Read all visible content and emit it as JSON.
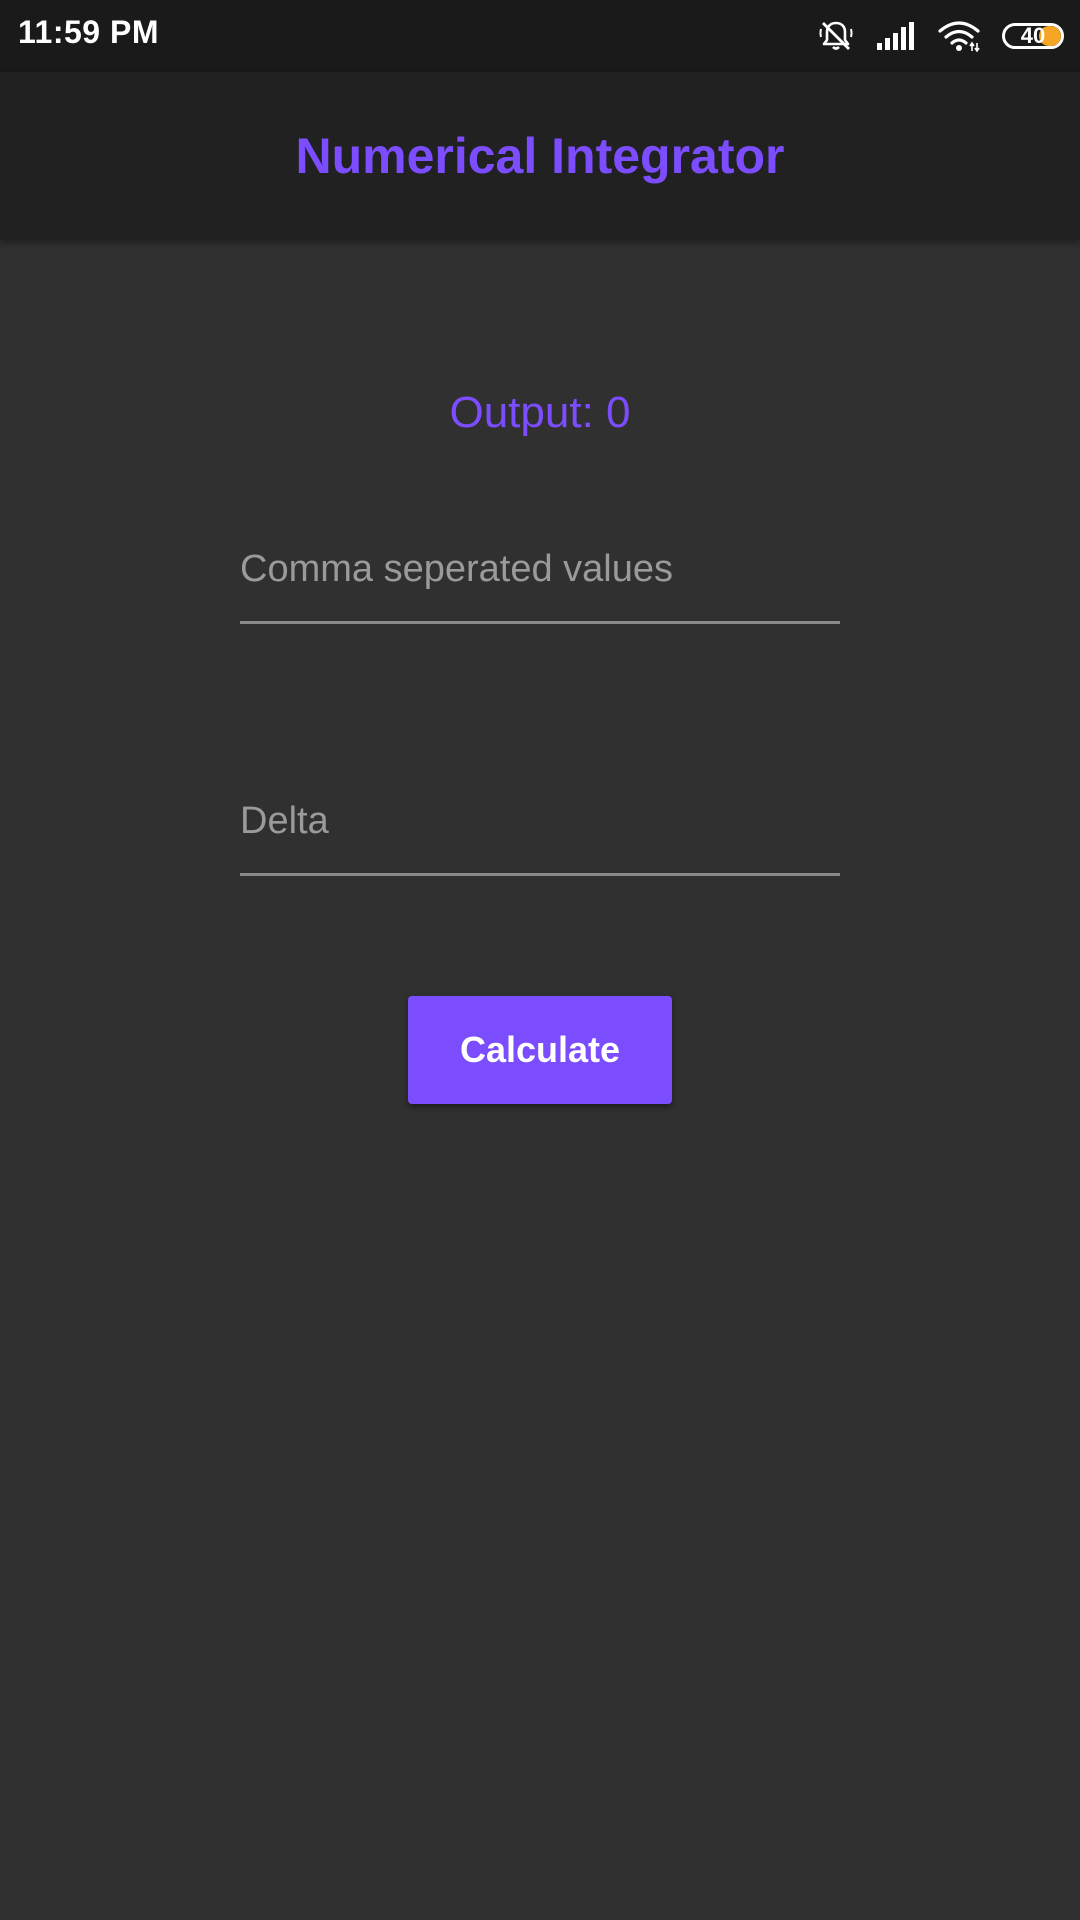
{
  "status_bar": {
    "time": "11:59 PM",
    "battery_level": "40",
    "battery_percent": 40,
    "icons": [
      "notifications-off-icon",
      "cellular-signal-icon",
      "wifi-icon",
      "battery-icon"
    ],
    "colors": {
      "background": "#1a1a1a",
      "battery_fill": "#f5a623"
    }
  },
  "app_bar": {
    "title": "Numerical Integrator"
  },
  "main": {
    "output_text": "Output: 0",
    "values_input": {
      "value": "",
      "placeholder": "Comma seperated values"
    },
    "delta_input": {
      "value": "",
      "placeholder": "Delta"
    },
    "calculate_label": "Calculate"
  },
  "colors": {
    "accent": "#7c4dff",
    "background": "#303030",
    "app_bar": "#212121"
  }
}
